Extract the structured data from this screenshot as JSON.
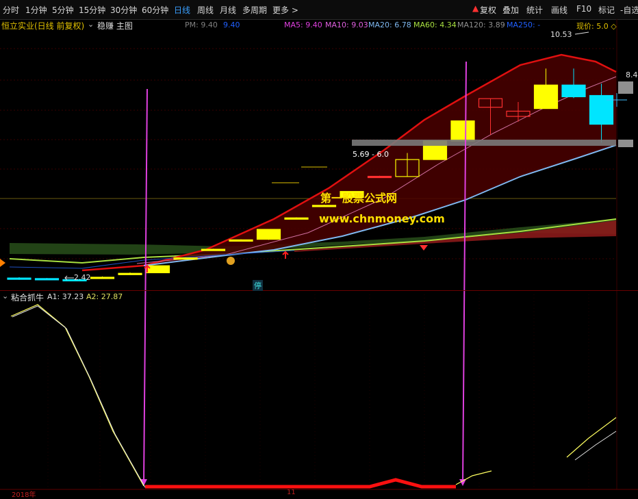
{
  "toolbar": {
    "periods": [
      "分时",
      "1分钟",
      "5分钟",
      "15分钟",
      "30分钟",
      "60分钟",
      "日线",
      "周线",
      "月线",
      "多周期",
      "更多 >"
    ],
    "active_period": "日线",
    "right_buttons": [
      "复权",
      "叠加",
      "统计",
      "画线",
      "F10",
      "标记",
      "-自选"
    ]
  },
  "info": {
    "stock_title": "恒立实业(日线 前复权)",
    "indicator_name": "稳赚 主图",
    "pm_label": "PM: 9.40",
    "pm_value": "9.40",
    "ma5": "MA5: 9.40",
    "ma10": "MA10: 9.03",
    "ma20": "MA20: 6.78",
    "ma60": "MA60: 4.34",
    "ma120": "MA120: 3.89",
    "ma250": "MA250: -",
    "current_price": "现价: 5.0 ◇"
  },
  "main_chart": {
    "high_label": "10.53",
    "low_label": "2.42",
    "range_label": "5.69 - 6.0",
    "right_price": "8.4",
    "stop_badge": "停",
    "watermark_line1": "第一股票公式网",
    "watermark_line2": "www.chnmoney.com",
    "candles": [
      {
        "o": 2.52,
        "c": 2.48,
        "h": 2.55,
        "l": 2.45
      },
      {
        "o": 2.5,
        "c": 2.47,
        "h": 2.52,
        "l": 2.44
      },
      {
        "o": 2.46,
        "c": 2.44,
        "h": 2.48,
        "l": 2.42
      },
      {
        "o": 2.55,
        "c": 2.55,
        "h": 2.58,
        "l": 2.52
      },
      {
        "o": 2.7,
        "c": 2.7,
        "h": 2.73,
        "l": 2.67
      },
      {
        "o": 2.72,
        "c": 2.99,
        "h": 2.99,
        "l": 2.72
      },
      {
        "o": 3.29,
        "c": 3.29,
        "h": 3.31,
        "l": 3.27
      },
      {
        "o": 3.62,
        "c": 3.62,
        "h": 3.64,
        "l": 3.6
      },
      {
        "o": 3.98,
        "c": 3.98,
        "h": 4.0,
        "l": 3.96
      },
      {
        "o": 4.0,
        "c": 4.38,
        "h": 4.38,
        "l": 3.98
      },
      {
        "o": 4.82,
        "c": 4.82,
        "h": 4.84,
        "l": 4.8
      },
      {
        "o": 5.3,
        "c": 5.3,
        "h": 5.32,
        "l": 5.28
      },
      {
        "o": 5.6,
        "c": 5.83,
        "h": 5.83,
        "l": 5.58
      },
      {
        "o": 6.41,
        "c": 6.41,
        "h": 6.43,
        "l": 6.39
      },
      {
        "o": 6.4,
        "c": 7.05,
        "h": 7.3,
        "l": 6.4
      },
      {
        "o": 7.05,
        "c": 7.76,
        "h": 7.76,
        "l": 7.05
      },
      {
        "o": 7.76,
        "c": 8.53,
        "h": 8.53,
        "l": 7.76
      },
      {
        "o": 9.38,
        "c": 9.05,
        "h": 9.38,
        "l": 8.0
      },
      {
        "o": 8.7,
        "c": 8.9,
        "h": 9.25,
        "l": 8.5
      },
      {
        "o": 9.0,
        "c": 9.9,
        "h": 10.53,
        "l": 9.0
      },
      {
        "o": 9.9,
        "c": 9.45,
        "h": 10.53,
        "l": 9.4
      },
      {
        "o": 9.5,
        "c": 8.4,
        "h": 9.95,
        "l": 7.7
      }
    ]
  },
  "sub_chart": {
    "indicator_name": "粘合抓牛",
    "a1": "A1: 37.23",
    "a2": "A2: 27.87"
  },
  "x_axis": {
    "year_label": "2018年",
    "month_label": "11"
  },
  "colors": {
    "up_yellow": "#ffff00",
    "up_red": "#ff3030",
    "down_cyan": "#00e5ff",
    "ma_red": "#e01010",
    "ma_blue": "#7fb8f0",
    "ma_green": "#a8e040",
    "magenta": "#e040e0"
  }
}
